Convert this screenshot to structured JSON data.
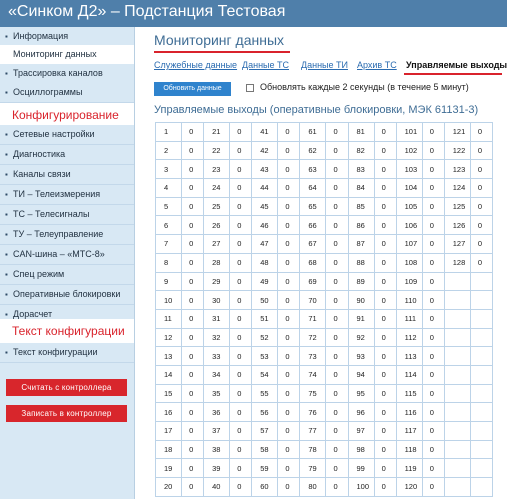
{
  "header": {
    "title": "«Синком Д2» – Подстанция Тестовая"
  },
  "sidebar": {
    "items_top": [
      {
        "label": "Информация",
        "active": false
      },
      {
        "label": "Мониторинг данных",
        "active": true
      },
      {
        "label": "Трассировка каналов",
        "active": false
      },
      {
        "label": "Осциллограммы",
        "active": false
      }
    ],
    "section_config": "Конфигурирование",
    "items_config": [
      "Сетевые настройки",
      "Диагностика",
      "Каналы связи",
      "ТИ – Телеизмерения",
      "ТС – Телесигналы",
      "ТУ – Телеуправление",
      "CAN-шина – «МТС-8»",
      "Спец режим",
      "Оперативные блокировки",
      "Дорасчет"
    ],
    "section_text": "Текст конфигурации",
    "items_text": [
      "Текст конфигурации"
    ],
    "read_button": "Считать с контроллера",
    "write_button": "Записать в контроллер"
  },
  "main": {
    "title": "Мониторинг данных",
    "tabs": [
      {
        "label": "Служебные данные",
        "active": false
      },
      {
        "label": "Данные ТС",
        "active": false
      },
      {
        "label": "Данные ТИ",
        "active": false
      },
      {
        "label": "Архив ТС",
        "active": false
      },
      {
        "label": "Управляемые выходы",
        "active": true
      }
    ],
    "update_button": "Обновить данные",
    "auto_update_label": "Обновлять каждые 2 секунды (в течение 5 минут)",
    "auto_update_checked": false,
    "subtitle": "Управляемые выходы (оперативные блокировки, МЭК 61131-3)",
    "grid": {
      "numbers_per_column": 20,
      "columns": 7,
      "max_number": 128,
      "value": "0"
    }
  },
  "colors": {
    "header_bg": "#4f7faa",
    "sidebar_bg": "#d8e8f4",
    "accent_red": "#d9232c",
    "button_blue": "#2f83cd",
    "title_blue": "#3f6d95"
  }
}
